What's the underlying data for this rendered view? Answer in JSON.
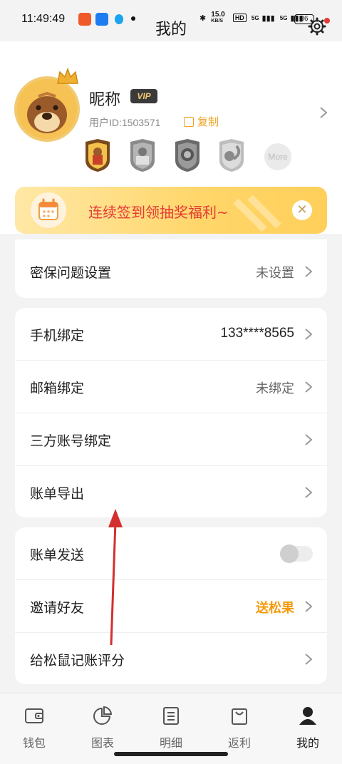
{
  "status_bar": {
    "time": "11:49:49",
    "network_speed": "15.0",
    "network_unit": "KB/S",
    "hd_label": "HD",
    "signal_1": "5G",
    "signal_2": "5G",
    "battery": "36"
  },
  "page_title": "我的",
  "profile": {
    "nickname": "昵称",
    "vip_label": "VIP",
    "user_id": "用户ID:1503571",
    "copy_label": "复制",
    "more_badge_label": "More"
  },
  "banner": {
    "text": "连续签到领抽奖福利~",
    "close_glyph": "✕"
  },
  "card_security": {
    "rows": [
      {
        "label": "密保问题设置",
        "value": "未设置"
      }
    ]
  },
  "card_account": {
    "rows": [
      {
        "label": "手机绑定",
        "value": "133****8565"
      },
      {
        "label": "邮箱绑定",
        "value": "未绑定"
      },
      {
        "label": "三方账号绑定",
        "value": ""
      },
      {
        "label": "账单导出",
        "value": ""
      }
    ]
  },
  "card_social": {
    "rows": [
      {
        "label": "账单发送",
        "value": "",
        "toggle_on": false
      },
      {
        "label": "邀请好友",
        "value": "送松果"
      },
      {
        "label": "给松鼠记账评分",
        "value": ""
      }
    ]
  },
  "bottom_nav": {
    "items": [
      {
        "label": "钱包",
        "icon": "wallet-icon"
      },
      {
        "label": "图表",
        "icon": "pie-chart-icon"
      },
      {
        "label": "明细",
        "icon": "list-icon"
      },
      {
        "label": "返利",
        "icon": "shopping-bag-icon"
      },
      {
        "label": "我的",
        "icon": "user-icon",
        "active": true
      }
    ]
  },
  "colors": {
    "accent": "#f59a0c",
    "banner_text": "#e53935",
    "annotation_arrow": "#d32f2f"
  }
}
